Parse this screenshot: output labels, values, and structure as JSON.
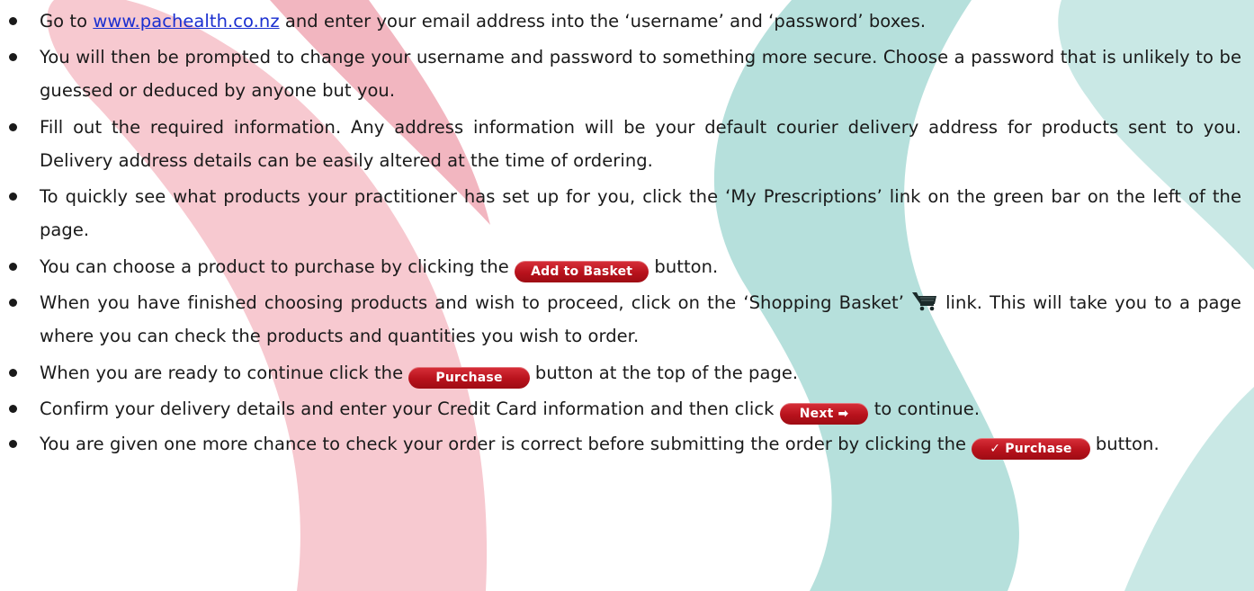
{
  "steps": [
    {
      "before": "Go to ",
      "link": "www.pachealth.co.nz",
      "after": " and enter your email address into the ‘username’ and ‘password’ boxes."
    },
    {
      "text": "You will then be prompted to change your username and password to something more secure. Choose a password that is unlikely to be guessed or deduced by anyone but you."
    },
    {
      "text": "Fill out the required information. Any address information will be your default courier delivery address for products sent to you. Delivery address details can be easily altered at the time of ordering."
    },
    {
      "text": "To quickly see what products your practitioner has set up for you, click the ‘My Prescriptions’ link on the green bar on the left of the page."
    },
    {
      "before": "You can choose a product to purchase by clicking the ",
      "button": "Add to Basket",
      "after": " button."
    },
    {
      "before": "When you have finished choosing products and wish to proceed, click on the ‘Shopping Basket’ ",
      "icon": "shopping-cart-icon",
      "after": " link. This will take you to a page where you can check the products and quantities you wish to order."
    },
    {
      "before": "When you are ready to continue click the ",
      "button": "Purchase",
      "after": " button at the top of the page."
    },
    {
      "before": "Confirm your delivery details and enter your Credit Card information and then click ",
      "button": "Next ➡",
      "after": " to continue."
    },
    {
      "before": "You are given one more chance to check your order is correct before submitting the order by clicking the ",
      "button": "✓ Purchase",
      "after": " button."
    }
  ],
  "colors": {
    "background_pink": "#f7c9d0",
    "background_teal": "#b6e0dc",
    "button_red": "#b8121c",
    "link_blue": "#1a2fd0"
  }
}
